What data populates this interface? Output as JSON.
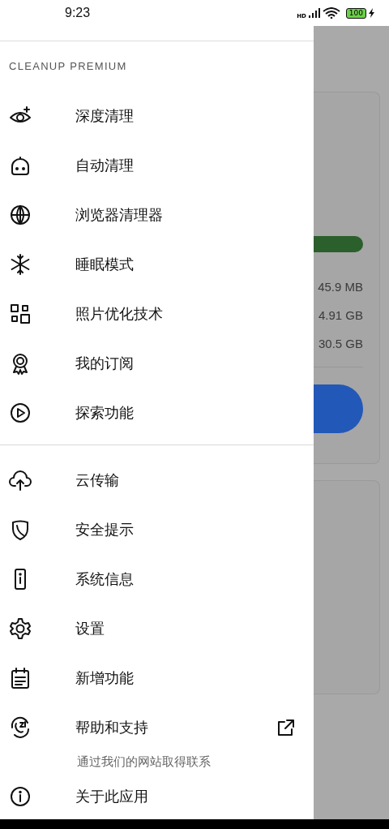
{
  "status_bar": {
    "time": "9:23",
    "network": "HD",
    "battery": "100"
  },
  "drawer": {
    "header": "CLEANUP PREMIUM",
    "sections": [
      {
        "items": [
          {
            "label": "深度清理"
          },
          {
            "label": "自动清理"
          },
          {
            "label": "浏览器清理器"
          },
          {
            "label": "睡眠模式"
          },
          {
            "label": "照片优化技术"
          },
          {
            "label": "我的订阅"
          },
          {
            "label": "探索功能"
          }
        ]
      },
      {
        "items": [
          {
            "label": "云传输"
          },
          {
            "label": "安全提示"
          },
          {
            "label": "系统信息"
          },
          {
            "label": "设置"
          },
          {
            "label": "新增功能"
          },
          {
            "label": "帮助和支持",
            "subtitle": "通过我们的网站取得联系",
            "external": true
          },
          {
            "label": "关于此应用"
          }
        ]
      }
    ]
  },
  "backdrop": {
    "values": [
      "45.9 MB",
      "4.91 GB",
      "30.5 GB"
    ]
  }
}
